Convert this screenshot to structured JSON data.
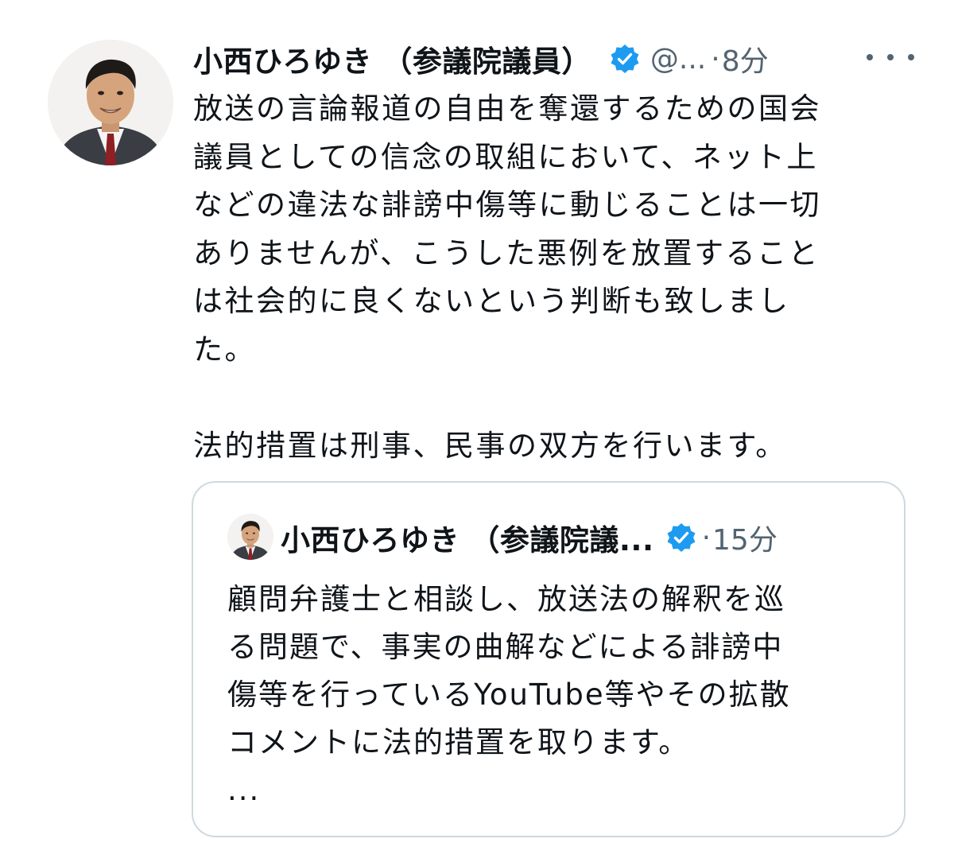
{
  "tweet": {
    "author_name": "小西ひろゆき （参議院議員）",
    "handle": "@...",
    "separator": "·",
    "time": "8分",
    "verified_icon": "verified-badge-icon",
    "more_icon": "more-options-icon",
    "text": "放送の言論報道の自由を奪還するための国会\n議員としての信念の取組において、ネット上\nなどの違法な誹謗中傷等に動じることは一切\nありませんが、こうした悪例を放置すること\nは社会的に良くないという判断も致しまし\nた。\n\n法的措置は刑事、民事の双方を行います。"
  },
  "quoted_tweet": {
    "author_name": "小西ひろゆき （参議院議...",
    "separator": "·",
    "time": "15分",
    "verified_icon": "verified-badge-icon",
    "text": "顧問弁護士と相談し、放送法の解釈を巡\nる問題で、事実の曲解などによる誹謗中\n傷等を行っているYouTube等やその拡散\nコメントに法的措置を取ります。\n..."
  },
  "colors": {
    "text": "#0f1419",
    "secondary": "#536471",
    "verified": "#1d9bf0",
    "border": "#cfd9de"
  }
}
